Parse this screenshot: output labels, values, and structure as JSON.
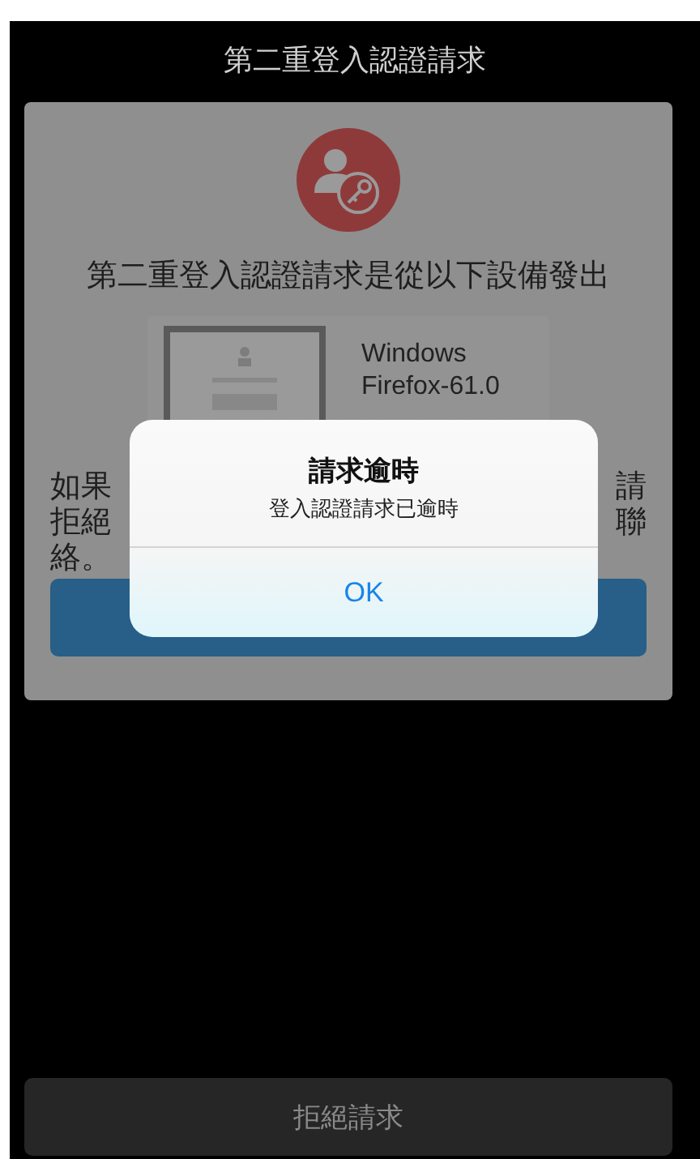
{
  "header": {
    "title": "第二重登入認證請求"
  },
  "card": {
    "heading": "第二重登入認證請求是從以下設備發出",
    "device": {
      "lines": [
        "Windows",
        "Firefox-61.0"
      ]
    },
    "notice_left": [
      "如果",
      "拒絕",
      "絡。"
    ],
    "notice_right": [
      "請",
      "聯"
    ]
  },
  "dialog": {
    "title": "請求逾時",
    "message": "登入認證請求已逾時",
    "button": "OK"
  },
  "footer": {
    "button": "拒絕請求"
  }
}
